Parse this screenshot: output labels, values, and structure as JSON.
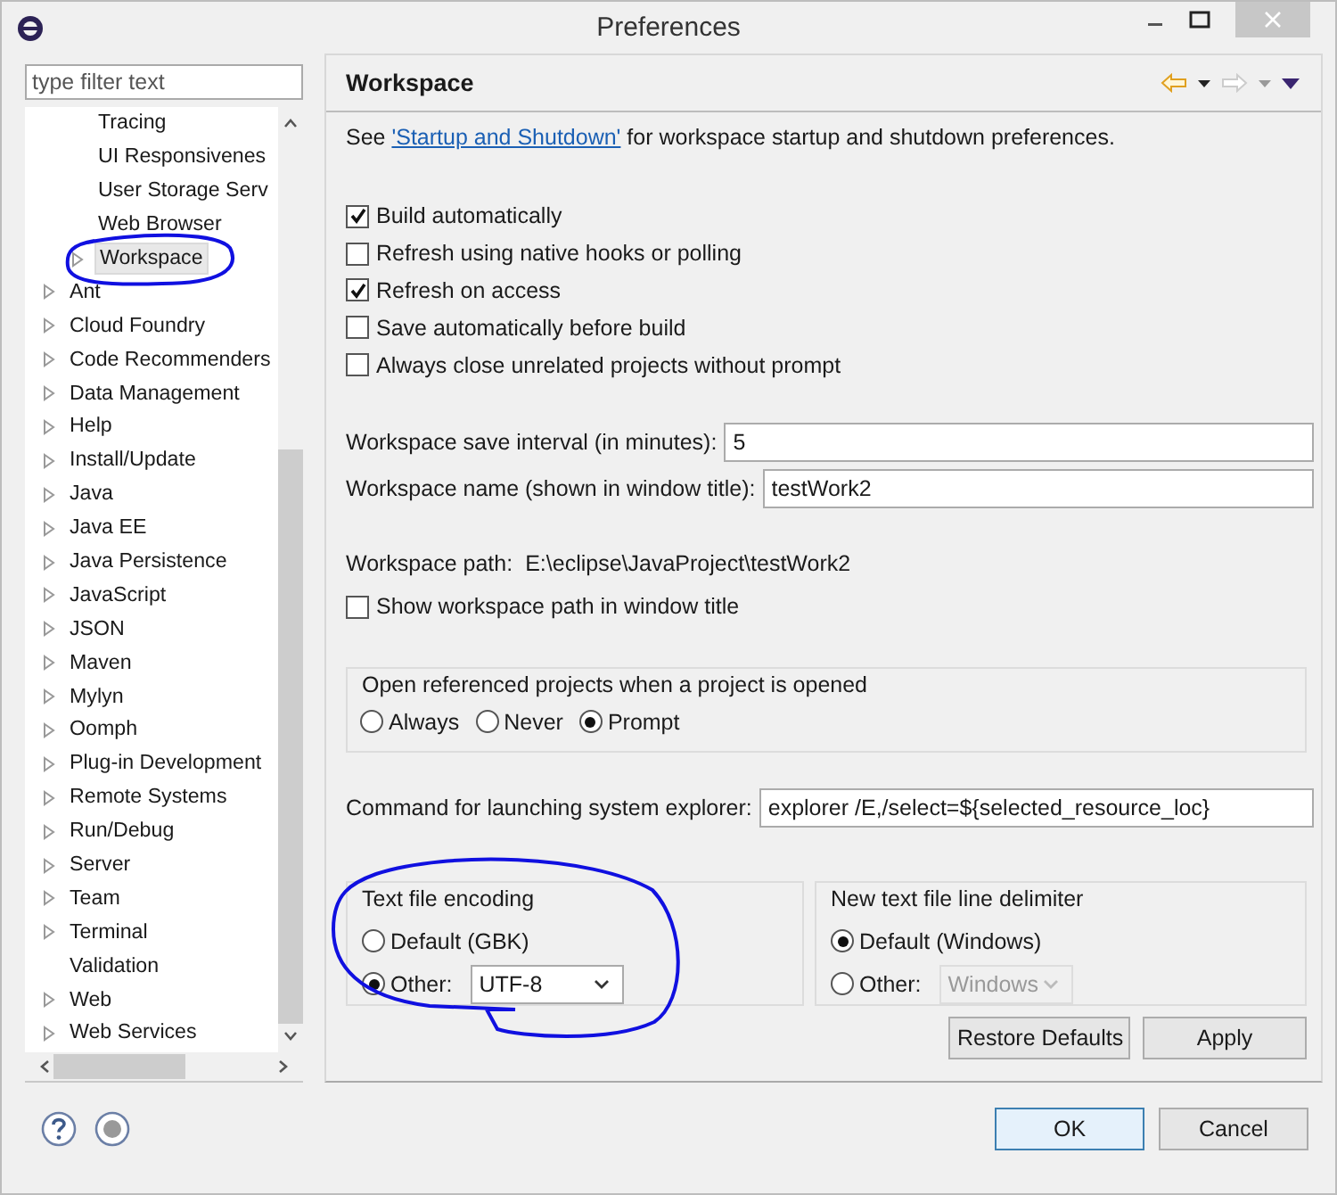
{
  "window": {
    "title": "Preferences"
  },
  "filter": {
    "placeholder": "type filter text"
  },
  "tree": {
    "items": [
      {
        "children": [
          {
            "label": "Tracing",
            "expandable": false,
            "selected": false
          },
          {
            "label": "UI Responsivenes",
            "expandable": false,
            "selected": false
          },
          {
            "label": "User Storage Serv",
            "expandable": false,
            "selected": false
          },
          {
            "label": "Web Browser",
            "expandable": false,
            "selected": false
          },
          {
            "label": "Workspace",
            "expandable": true,
            "selected": true
          }
        ]
      },
      {
        "label": "Ant",
        "expandable": true,
        "selected": false
      },
      {
        "label": "Cloud Foundry",
        "expandable": true,
        "selected": false
      },
      {
        "label": "Code Recommenders",
        "expandable": true,
        "selected": false
      },
      {
        "label": "Data Management",
        "expandable": true,
        "selected": false
      },
      {
        "label": "Help",
        "expandable": true,
        "selected": false
      },
      {
        "label": "Install/Update",
        "expandable": true,
        "selected": false
      },
      {
        "label": "Java",
        "expandable": true,
        "selected": false
      },
      {
        "label": "Java EE",
        "expandable": true,
        "selected": false
      },
      {
        "label": "Java Persistence",
        "expandable": true,
        "selected": false
      },
      {
        "label": "JavaScript",
        "expandable": true,
        "selected": false
      },
      {
        "label": "JSON",
        "expandable": true,
        "selected": false
      },
      {
        "label": "Maven",
        "expandable": true,
        "selected": false
      },
      {
        "label": "Mylyn",
        "expandable": true,
        "selected": false
      },
      {
        "label": "Oomph",
        "expandable": true,
        "selected": false
      },
      {
        "label": "Plug-in Development",
        "expandable": true,
        "selected": false
      },
      {
        "label": "Remote Systems",
        "expandable": true,
        "selected": false
      },
      {
        "label": "Run/Debug",
        "expandable": true,
        "selected": false
      },
      {
        "label": "Server",
        "expandable": true,
        "selected": false
      },
      {
        "label": "Team",
        "expandable": true,
        "selected": false
      },
      {
        "label": "Terminal",
        "expandable": true,
        "selected": false
      },
      {
        "label": "Validation",
        "expandable": false,
        "selected": false
      },
      {
        "label": "Web",
        "expandable": true,
        "selected": false
      },
      {
        "label": "Web Services",
        "expandable": true,
        "selected": false
      }
    ]
  },
  "page": {
    "title": "Workspace",
    "intro": {
      "before": "See ",
      "link": "'Startup and Shutdown'",
      "after": " for workspace startup and shutdown preferences."
    },
    "checkboxes": [
      {
        "label": "Build automatically",
        "checked": true
      },
      {
        "label": "Refresh using native hooks or polling",
        "checked": false
      },
      {
        "label": "Refresh on access",
        "checked": true
      },
      {
        "label": "Save automatically before build",
        "checked": false
      },
      {
        "label": "Always close unrelated projects without prompt",
        "checked": false
      }
    ],
    "fields": [
      {
        "label": "Workspace save interval (in minutes):",
        "value": "5"
      },
      {
        "label": "Workspace name (shown in window title):",
        "value": "testWork2"
      }
    ],
    "path": {
      "label": "Workspace path:",
      "value": "E:\\eclipse\\JavaProject\\testWork2"
    },
    "show_path": {
      "label": "Show workspace path in window title",
      "checked": false
    },
    "open_referenced": {
      "title": "Open referenced projects when a project is opened",
      "options": [
        {
          "label": "Always",
          "selected": false
        },
        {
          "label": "Never",
          "selected": false
        },
        {
          "label": "Prompt",
          "selected": true
        }
      ]
    },
    "command": {
      "label": "Command for launching system explorer:",
      "value": "explorer /E,/select=${selected_resource_loc}"
    },
    "encoding": {
      "title": "Text file encoding",
      "options": [
        {
          "label": "Default (GBK)",
          "selected": false
        },
        {
          "label": "Other:",
          "selected": true,
          "dropdown": {
            "value": "UTF-8",
            "disabled": false
          }
        }
      ]
    },
    "delimiter": {
      "title": "New text file line delimiter",
      "options": [
        {
          "label": "Default (Windows)",
          "selected": true
        },
        {
          "label": "Other:",
          "selected": false,
          "dropdown": {
            "value": "Windows",
            "disabled": true
          }
        }
      ]
    },
    "buttons": [
      "Restore Defaults",
      "Apply"
    ]
  },
  "footer_buttons": [
    {
      "label": "OK",
      "default": true
    },
    {
      "label": "Cancel",
      "default": false
    }
  ]
}
